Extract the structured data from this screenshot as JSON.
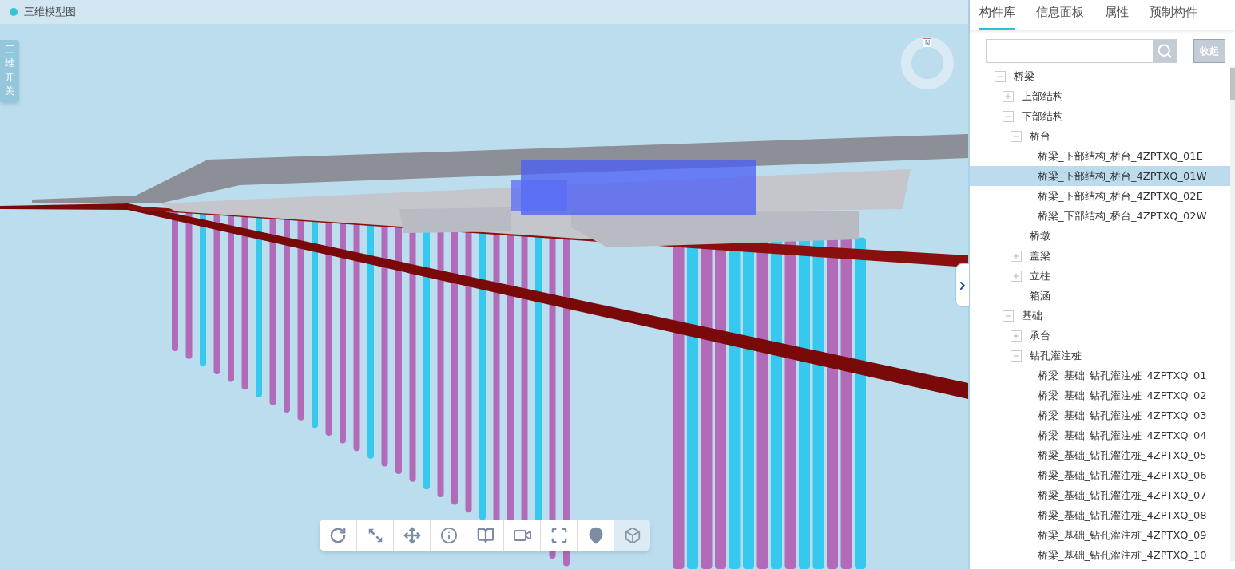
{
  "viewer": {
    "title": "三维模型图",
    "side_toggle": "三维开关",
    "compass": "N",
    "toolbar": [
      {
        "kind": "rotate",
        "selected": false
      },
      {
        "kind": "zoom",
        "selected": false
      },
      {
        "kind": "pan",
        "selected": false
      },
      {
        "kind": "info",
        "selected": false
      },
      {
        "kind": "section",
        "selected": false
      },
      {
        "kind": "camera",
        "selected": false
      },
      {
        "kind": "fullscreen",
        "selected": false
      },
      {
        "kind": "location",
        "selected": false
      },
      {
        "kind": "cube",
        "selected": true
      }
    ]
  },
  "panel": {
    "tabs": [
      {
        "label": "构件库",
        "selected": true
      },
      {
        "label": "信息面板",
        "selected": false
      },
      {
        "label": "属性",
        "selected": false
      },
      {
        "label": "预制构件",
        "selected": false
      }
    ],
    "search": {
      "button": "收起"
    },
    "tree": [
      {
        "label": "桥梁",
        "expanded": true,
        "selected": false,
        "children": [
          {
            "label": "上部结构",
            "expanded": false,
            "selected": false
          },
          {
            "label": "下部结构",
            "expanded": true,
            "selected": false,
            "children": [
              {
                "label": "桥台",
                "expanded": true,
                "selected": false,
                "children": [
                  {
                    "label": "桥梁_下部结构_桥台_4ZPTXQ_01E",
                    "selected": false
                  },
                  {
                    "label": "桥梁_下部结构_桥台_4ZPTXQ_01W",
                    "selected": true
                  },
                  {
                    "label": "桥梁_下部结构_桥台_4ZPTXQ_02E",
                    "selected": false
                  },
                  {
                    "label": "桥梁_下部结构_桥台_4ZPTXQ_02W",
                    "selected": false
                  }
                ]
              },
              {
                "label": "桥墩",
                "selected": false
              },
              {
                "label": "盖梁",
                "expanded": false,
                "selected": false
              },
              {
                "label": "立柱",
                "expanded": false,
                "selected": false
              },
              {
                "label": "箱涵",
                "selected": false
              }
            ]
          },
          {
            "label": "基础",
            "expanded": true,
            "selected": false,
            "children": [
              {
                "label": "承台",
                "expanded": false,
                "selected": false
              },
              {
                "label": "钻孔灌注桩",
                "expanded": true,
                "selected": false,
                "children": [
                  {
                    "label": "桥梁_基础_钻孔灌注桩_4ZPTXQ_01",
                    "selected": false
                  },
                  {
                    "label": "桥梁_基础_钻孔灌注桩_4ZPTXQ_02",
                    "selected": false
                  },
                  {
                    "label": "桥梁_基础_钻孔灌注桩_4ZPTXQ_03",
                    "selected": false
                  },
                  {
                    "label": "桥梁_基础_钻孔灌注桩_4ZPTXQ_04",
                    "selected": false
                  },
                  {
                    "label": "桥梁_基础_钻孔灌注桩_4ZPTXQ_05",
                    "selected": false
                  },
                  {
                    "label": "桥梁_基础_钻孔灌注桩_4ZPTXQ_06",
                    "selected": false
                  },
                  {
                    "label": "桥梁_基础_钻孔灌注桩_4ZPTXQ_07",
                    "selected": false
                  },
                  {
                    "label": "桥梁_基础_钻孔灌注桩_4ZPTXQ_08",
                    "selected": false
                  },
                  {
                    "label": "桥梁_基础_钻孔灌注桩_4ZPTXQ_09",
                    "selected": false
                  },
                  {
                    "label": "桥梁_基础_钻孔灌注桩_4ZPTXQ_10",
                    "selected": false
                  }
                ]
              }
            ]
          }
        ]
      }
    ]
  }
}
